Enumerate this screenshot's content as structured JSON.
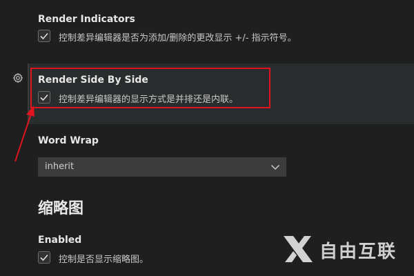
{
  "settings": {
    "render_indicators": {
      "title": "Render Indicators",
      "description": "控制差异编辑器是否为添加/删除的更改显示 +/- 指示符号。",
      "checked": true
    },
    "render_side_by_side": {
      "title": "Render Side By Side",
      "description": "控制差异编辑器的显示方式是并排还是内联。",
      "checked": true
    },
    "word_wrap": {
      "title": "Word Wrap",
      "value": "inherit"
    }
  },
  "minimap_section": {
    "title": "缩略图",
    "enabled": {
      "title": "Enabled",
      "description": "控制是否显示缩略图。",
      "checked": true
    }
  },
  "watermark": {
    "text": "自由互联"
  },
  "colors": {
    "highlight_box": "#e0141e",
    "annotation_arrow": "#e0141e",
    "background": "#1f1f1f",
    "focused_row": "#2a2d2e"
  },
  "icons": [
    "gear-icon",
    "checkmark-icon",
    "chevron-down-icon",
    "arrow-annotation"
  ]
}
